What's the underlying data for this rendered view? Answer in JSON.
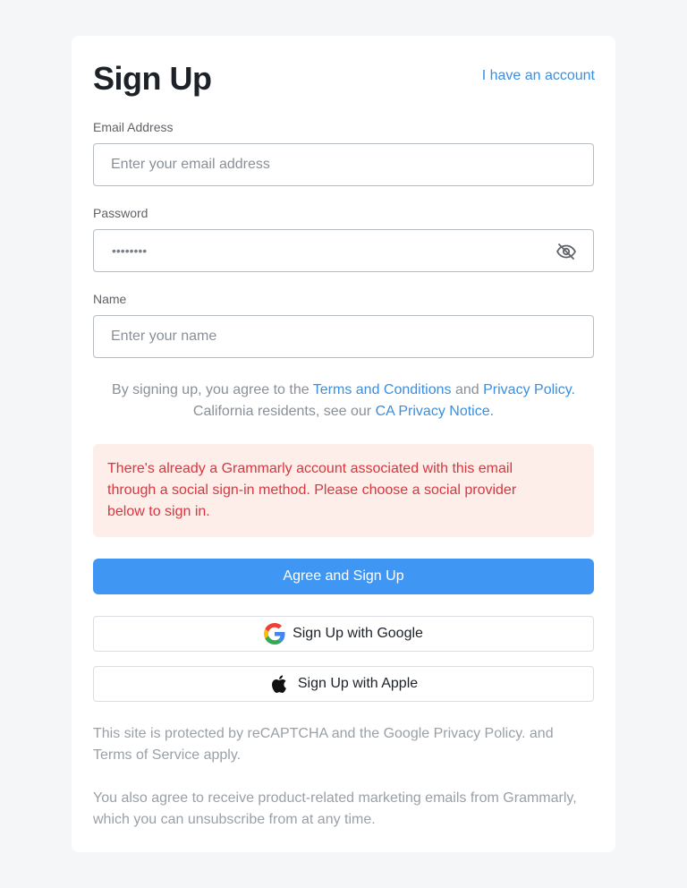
{
  "header": {
    "title": "Sign Up",
    "account_link": "I have an account"
  },
  "form": {
    "email": {
      "label": "Email Address",
      "value": "",
      "placeholder": "Enter your email address"
    },
    "password": {
      "label": "Password",
      "masked_value": "••••••••",
      "toggle_icon": "eye-off-icon"
    },
    "name": {
      "label": "Name",
      "value": "",
      "placeholder": "Enter your name"
    }
  },
  "legal": {
    "prefix": "By signing up, you agree to the ",
    "terms_link": "Terms and Conditions",
    "and": " and ",
    "privacy_link": "Privacy Policy.",
    "ca_prefix": "California residents, see our ",
    "ca_link": "CA Privacy Notice."
  },
  "error": {
    "message": "There's already a Grammarly account associated with this email through a social sign-in method. Please choose a social provider below to sign in."
  },
  "actions": {
    "primary_label": "Agree and Sign Up",
    "google_label": "Sign Up with Google",
    "google_icon": "google-icon",
    "apple_label": "Sign Up with Apple",
    "apple_icon": "apple-icon"
  },
  "footer": {
    "recaptcha": "This site is protected by reCAPTCHA and the Google Privacy Policy. and Terms of Service apply.",
    "marketing": "You also agree to receive product-related marketing emails from Grammarly, which you can unsubscribe from at any time."
  },
  "colors": {
    "accent": "#3b8ee0",
    "primary_button": "#4096f3",
    "error_bg": "#fdeeea",
    "error_text": "#d9363e",
    "page_bg": "#f5f6f8"
  }
}
